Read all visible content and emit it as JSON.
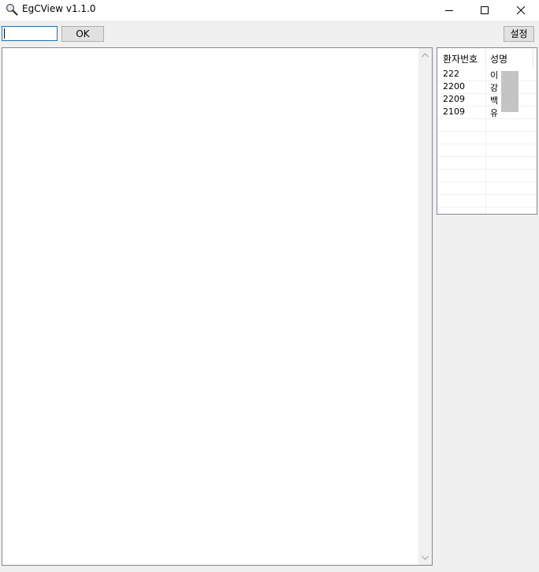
{
  "window": {
    "title": "EgCView v1.1.0",
    "icon": "magnifier-icon"
  },
  "toolbar": {
    "search_value": "",
    "ok_label": "OK",
    "settings_label": "설정"
  },
  "patient_list": {
    "columns": [
      "환자번호",
      "성명"
    ],
    "rows": [
      {
        "id": "222",
        "name": "이"
      },
      {
        "id": "2200",
        "name": "강"
      },
      {
        "id": "2209",
        "name": "백"
      },
      {
        "id": "2109",
        "name": "유"
      }
    ]
  },
  "colors": {
    "accent": "#0078d7",
    "window_bg": "#f0f0f0"
  }
}
